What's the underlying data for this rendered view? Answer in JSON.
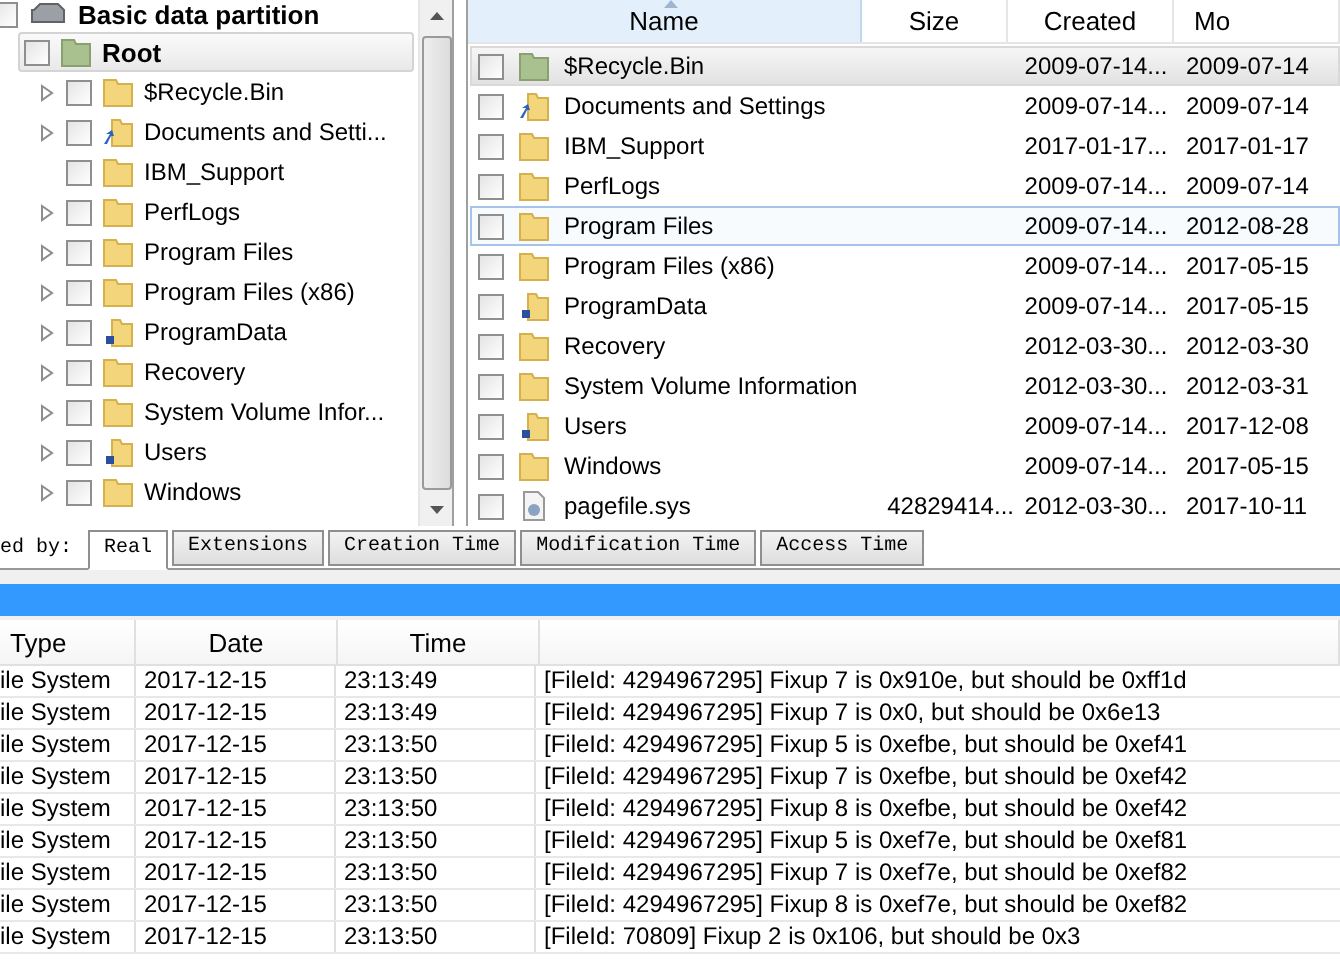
{
  "tree": {
    "partition": {
      "label": "Basic data partition",
      "checked": false
    },
    "root": {
      "label": "Root",
      "checked": false,
      "selected": true
    },
    "items": [
      {
        "label": "$Recycle.Bin",
        "kind": "folder",
        "expandable": true,
        "checked": false
      },
      {
        "label": "Documents and Setti...",
        "kind": "shortcut",
        "expandable": true,
        "checked": false
      },
      {
        "label": "IBM_Support",
        "kind": "folder",
        "expandable": false,
        "checked": false
      },
      {
        "label": "PerfLogs",
        "kind": "folder",
        "expandable": true,
        "checked": false
      },
      {
        "label": "Program Files",
        "kind": "folder",
        "expandable": true,
        "checked": false
      },
      {
        "label": "Program Files (x86)",
        "kind": "folder",
        "expandable": true,
        "checked": false
      },
      {
        "label": "ProgramData",
        "kind": "special",
        "expandable": true,
        "checked": false
      },
      {
        "label": "Recovery",
        "kind": "folder",
        "expandable": true,
        "checked": false
      },
      {
        "label": "System Volume Infor...",
        "kind": "folder",
        "expandable": true,
        "checked": false
      },
      {
        "label": "Users",
        "kind": "special",
        "expandable": true,
        "checked": false
      },
      {
        "label": "Windows",
        "kind": "folder",
        "expandable": true,
        "checked": false
      }
    ]
  },
  "file_list": {
    "columns": [
      {
        "label": "Name",
        "sorted": true
      },
      {
        "label": "Size",
        "sorted": false
      },
      {
        "label": "Created",
        "sorted": false
      },
      {
        "label": "Mo",
        "sorted": false
      }
    ],
    "rows": [
      {
        "name": "$Recycle.Bin",
        "kind": "bin",
        "size": "",
        "created": "2009-07-14...",
        "modified": "2009-07-14",
        "checked": false,
        "selected": true,
        "hovered": false
      },
      {
        "name": "Documents and Settings",
        "kind": "shortcut",
        "size": "",
        "created": "2009-07-14...",
        "modified": "2009-07-14",
        "checked": false,
        "selected": false,
        "hovered": false
      },
      {
        "name": "IBM_Support",
        "kind": "folder",
        "size": "",
        "created": "2017-01-17...",
        "modified": "2017-01-17",
        "checked": false,
        "selected": false,
        "hovered": false
      },
      {
        "name": "PerfLogs",
        "kind": "folder",
        "size": "",
        "created": "2009-07-14...",
        "modified": "2009-07-14",
        "checked": false,
        "selected": false,
        "hovered": false
      },
      {
        "name": "Program Files",
        "kind": "folder",
        "size": "",
        "created": "2009-07-14...",
        "modified": "2012-08-28",
        "checked": false,
        "selected": false,
        "hovered": true
      },
      {
        "name": "Program Files (x86)",
        "kind": "folder",
        "size": "",
        "created": "2009-07-14...",
        "modified": "2017-05-15",
        "checked": false,
        "selected": false,
        "hovered": false
      },
      {
        "name": "ProgramData",
        "kind": "special",
        "size": "",
        "created": "2009-07-14...",
        "modified": "2017-05-15",
        "checked": false,
        "selected": false,
        "hovered": false
      },
      {
        "name": "Recovery",
        "kind": "folder",
        "size": "",
        "created": "2012-03-30...",
        "modified": "2012-03-30",
        "checked": false,
        "selected": false,
        "hovered": false
      },
      {
        "name": "System Volume Information",
        "kind": "folder",
        "size": "",
        "created": "2012-03-30...",
        "modified": "2012-03-31",
        "checked": false,
        "selected": false,
        "hovered": false
      },
      {
        "name": "Users",
        "kind": "special",
        "size": "",
        "created": "2009-07-14...",
        "modified": "2017-12-08",
        "checked": false,
        "selected": false,
        "hovered": false
      },
      {
        "name": "Windows",
        "kind": "folder",
        "size": "",
        "created": "2009-07-14...",
        "modified": "2017-05-15",
        "checked": false,
        "selected": false,
        "hovered": false
      },
      {
        "name": "pagefile.sys",
        "kind": "file",
        "size": "42829414...",
        "created": "2012-03-30...",
        "modified": "2017-10-11",
        "checked": false,
        "selected": false,
        "hovered": false
      }
    ]
  },
  "sort_bar": {
    "label": "ed by:",
    "tabs": [
      {
        "label": "Real",
        "selected": true
      },
      {
        "label": "Extensions",
        "selected": false
      },
      {
        "label": "Creation Time",
        "selected": false
      },
      {
        "label": "Modification Time",
        "selected": false
      },
      {
        "label": "Access Time",
        "selected": false
      }
    ]
  },
  "log": {
    "columns": [
      "Type",
      "Date",
      "Time"
    ],
    "rows": [
      {
        "type": "ile System",
        "date": "2017-12-15",
        "time": "23:13:49",
        "message": "[FileId: 4294967295] Fixup 7 is 0x910e, but should be 0xff1d"
      },
      {
        "type": "ile System",
        "date": "2017-12-15",
        "time": "23:13:49",
        "message": "[FileId: 4294967295] Fixup 7 is 0x0, but should be 0x6e13"
      },
      {
        "type": "ile System",
        "date": "2017-12-15",
        "time": "23:13:50",
        "message": "[FileId: 4294967295] Fixup 5 is 0xefbe, but should be 0xef41"
      },
      {
        "type": "ile System",
        "date": "2017-12-15",
        "time": "23:13:50",
        "message": "[FileId: 4294967295] Fixup 7 is 0xefbe, but should be 0xef42"
      },
      {
        "type": "ile System",
        "date": "2017-12-15",
        "time": "23:13:50",
        "message": "[FileId: 4294967295] Fixup 8 is 0xefbe, but should be 0xef42"
      },
      {
        "type": "ile System",
        "date": "2017-12-15",
        "time": "23:13:50",
        "message": "[FileId: 4294967295] Fixup 5 is 0xef7e, but should be 0xef81"
      },
      {
        "type": "ile System",
        "date": "2017-12-15",
        "time": "23:13:50",
        "message": "[FileId: 4294967295] Fixup 7 is 0xef7e, but should be 0xef82"
      },
      {
        "type": "ile System",
        "date": "2017-12-15",
        "time": "23:13:50",
        "message": "[FileId: 4294967295] Fixup 8 is 0xef7e, but should be 0xef82"
      },
      {
        "type": "ile System",
        "date": "2017-12-15",
        "time": "23:13:50",
        "message": "[FileId: 70809] Fixup 2 is 0x106, but should be 0x3"
      }
    ]
  }
}
